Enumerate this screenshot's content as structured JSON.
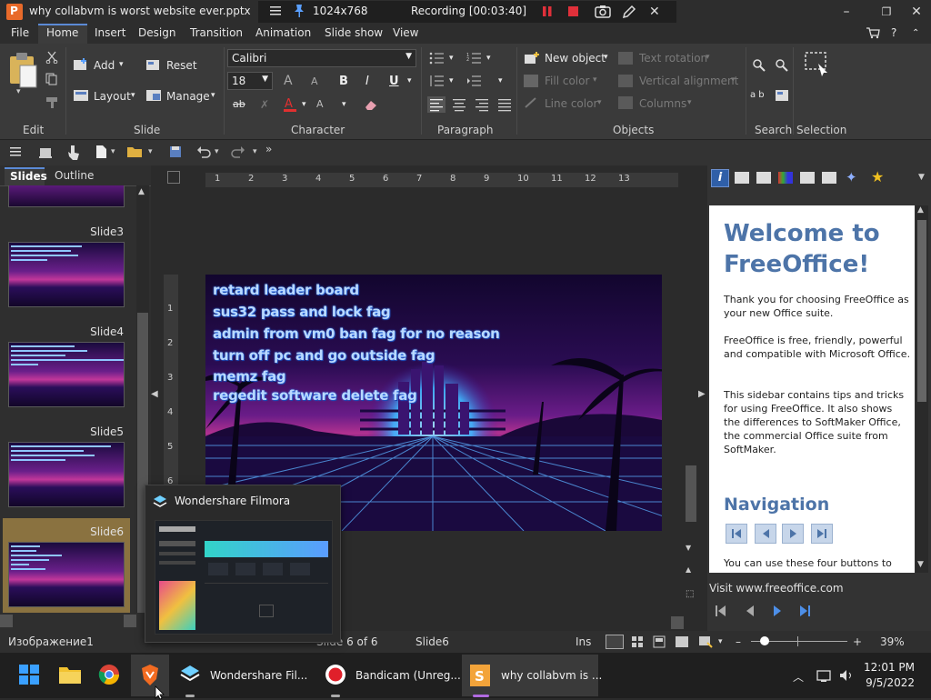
{
  "window": {
    "title": "why collabvm is worst website ever.pptx - Pre",
    "resolution": "1024x768",
    "recording": "Recording [00:03:40]"
  },
  "menu": [
    "File",
    "Home",
    "Insert",
    "Design",
    "Transition",
    "Animation",
    "Slide show",
    "View"
  ],
  "ribbon": {
    "add": "Add",
    "reset": "Reset",
    "layout": "Layout",
    "manage": "Manage",
    "font": "Calibri",
    "size": "18",
    "new_object": "New object",
    "fill_color": "Fill color",
    "line_color": "Line color",
    "text_rotation": "Text rotation",
    "vertical_alignment": "Vertical alignment",
    "columns": "Columns",
    "groups": {
      "edit": "Edit",
      "slide": "Slide",
      "character": "Character",
      "paragraph": "Paragraph",
      "objects": "Objects",
      "search": "Search",
      "selection": "Selection"
    }
  },
  "panel": {
    "tab_slides": "Slides",
    "tab_outline": "Outline",
    "slides": [
      {
        "label": "Slide3"
      },
      {
        "label": "Slide4"
      },
      {
        "label": "Slide5"
      },
      {
        "label": "Slide6"
      }
    ]
  },
  "ruler": [
    "1",
    "2",
    "3",
    "4",
    "5",
    "6",
    "7",
    "8",
    "9",
    "10",
    "11",
    "12",
    "13"
  ],
  "vruler": [
    "1",
    "2",
    "3",
    "4",
    "5",
    "6"
  ],
  "slide_lines": [
    "retard leader board",
    "sus32 pass and lock fag",
    "admin from vm0 ban fag for no reason",
    "turn off pc and go outside fag",
    "memz fag",
    "regedit software delete fag"
  ],
  "sidebar": {
    "heading": "Welcome to FreeOffice!",
    "p1": "Thank you for choosing FreeOffice as your new Office suite.",
    "p2": "FreeOffice is free, friendly, powerful and compatible with Microsoft Office.",
    "p3": "This sidebar contains tips and tricks for using FreeOffice. It also shows the differences to SoftMaker Office, the commercial Office suite from SoftMaker.",
    "nav_heading": "Navigation",
    "p4": "You can use these four buttons to navigate between the pages of this",
    "visit": "Visit www.freeoffice.com"
  },
  "status": {
    "object": "Изображение1",
    "page": "Slide 6 of 6",
    "slide": "Slide6",
    "mode": "Ins",
    "zoom": "39%"
  },
  "taskbar": {
    "filmora": "Wondershare Fil...",
    "bandicam": "Bandicam (Unreg...",
    "freeoffice": "why collabvm is ...",
    "time": "12:01 PM",
    "date": "9/5/2022",
    "preview_title": "Wondershare Filmora"
  }
}
